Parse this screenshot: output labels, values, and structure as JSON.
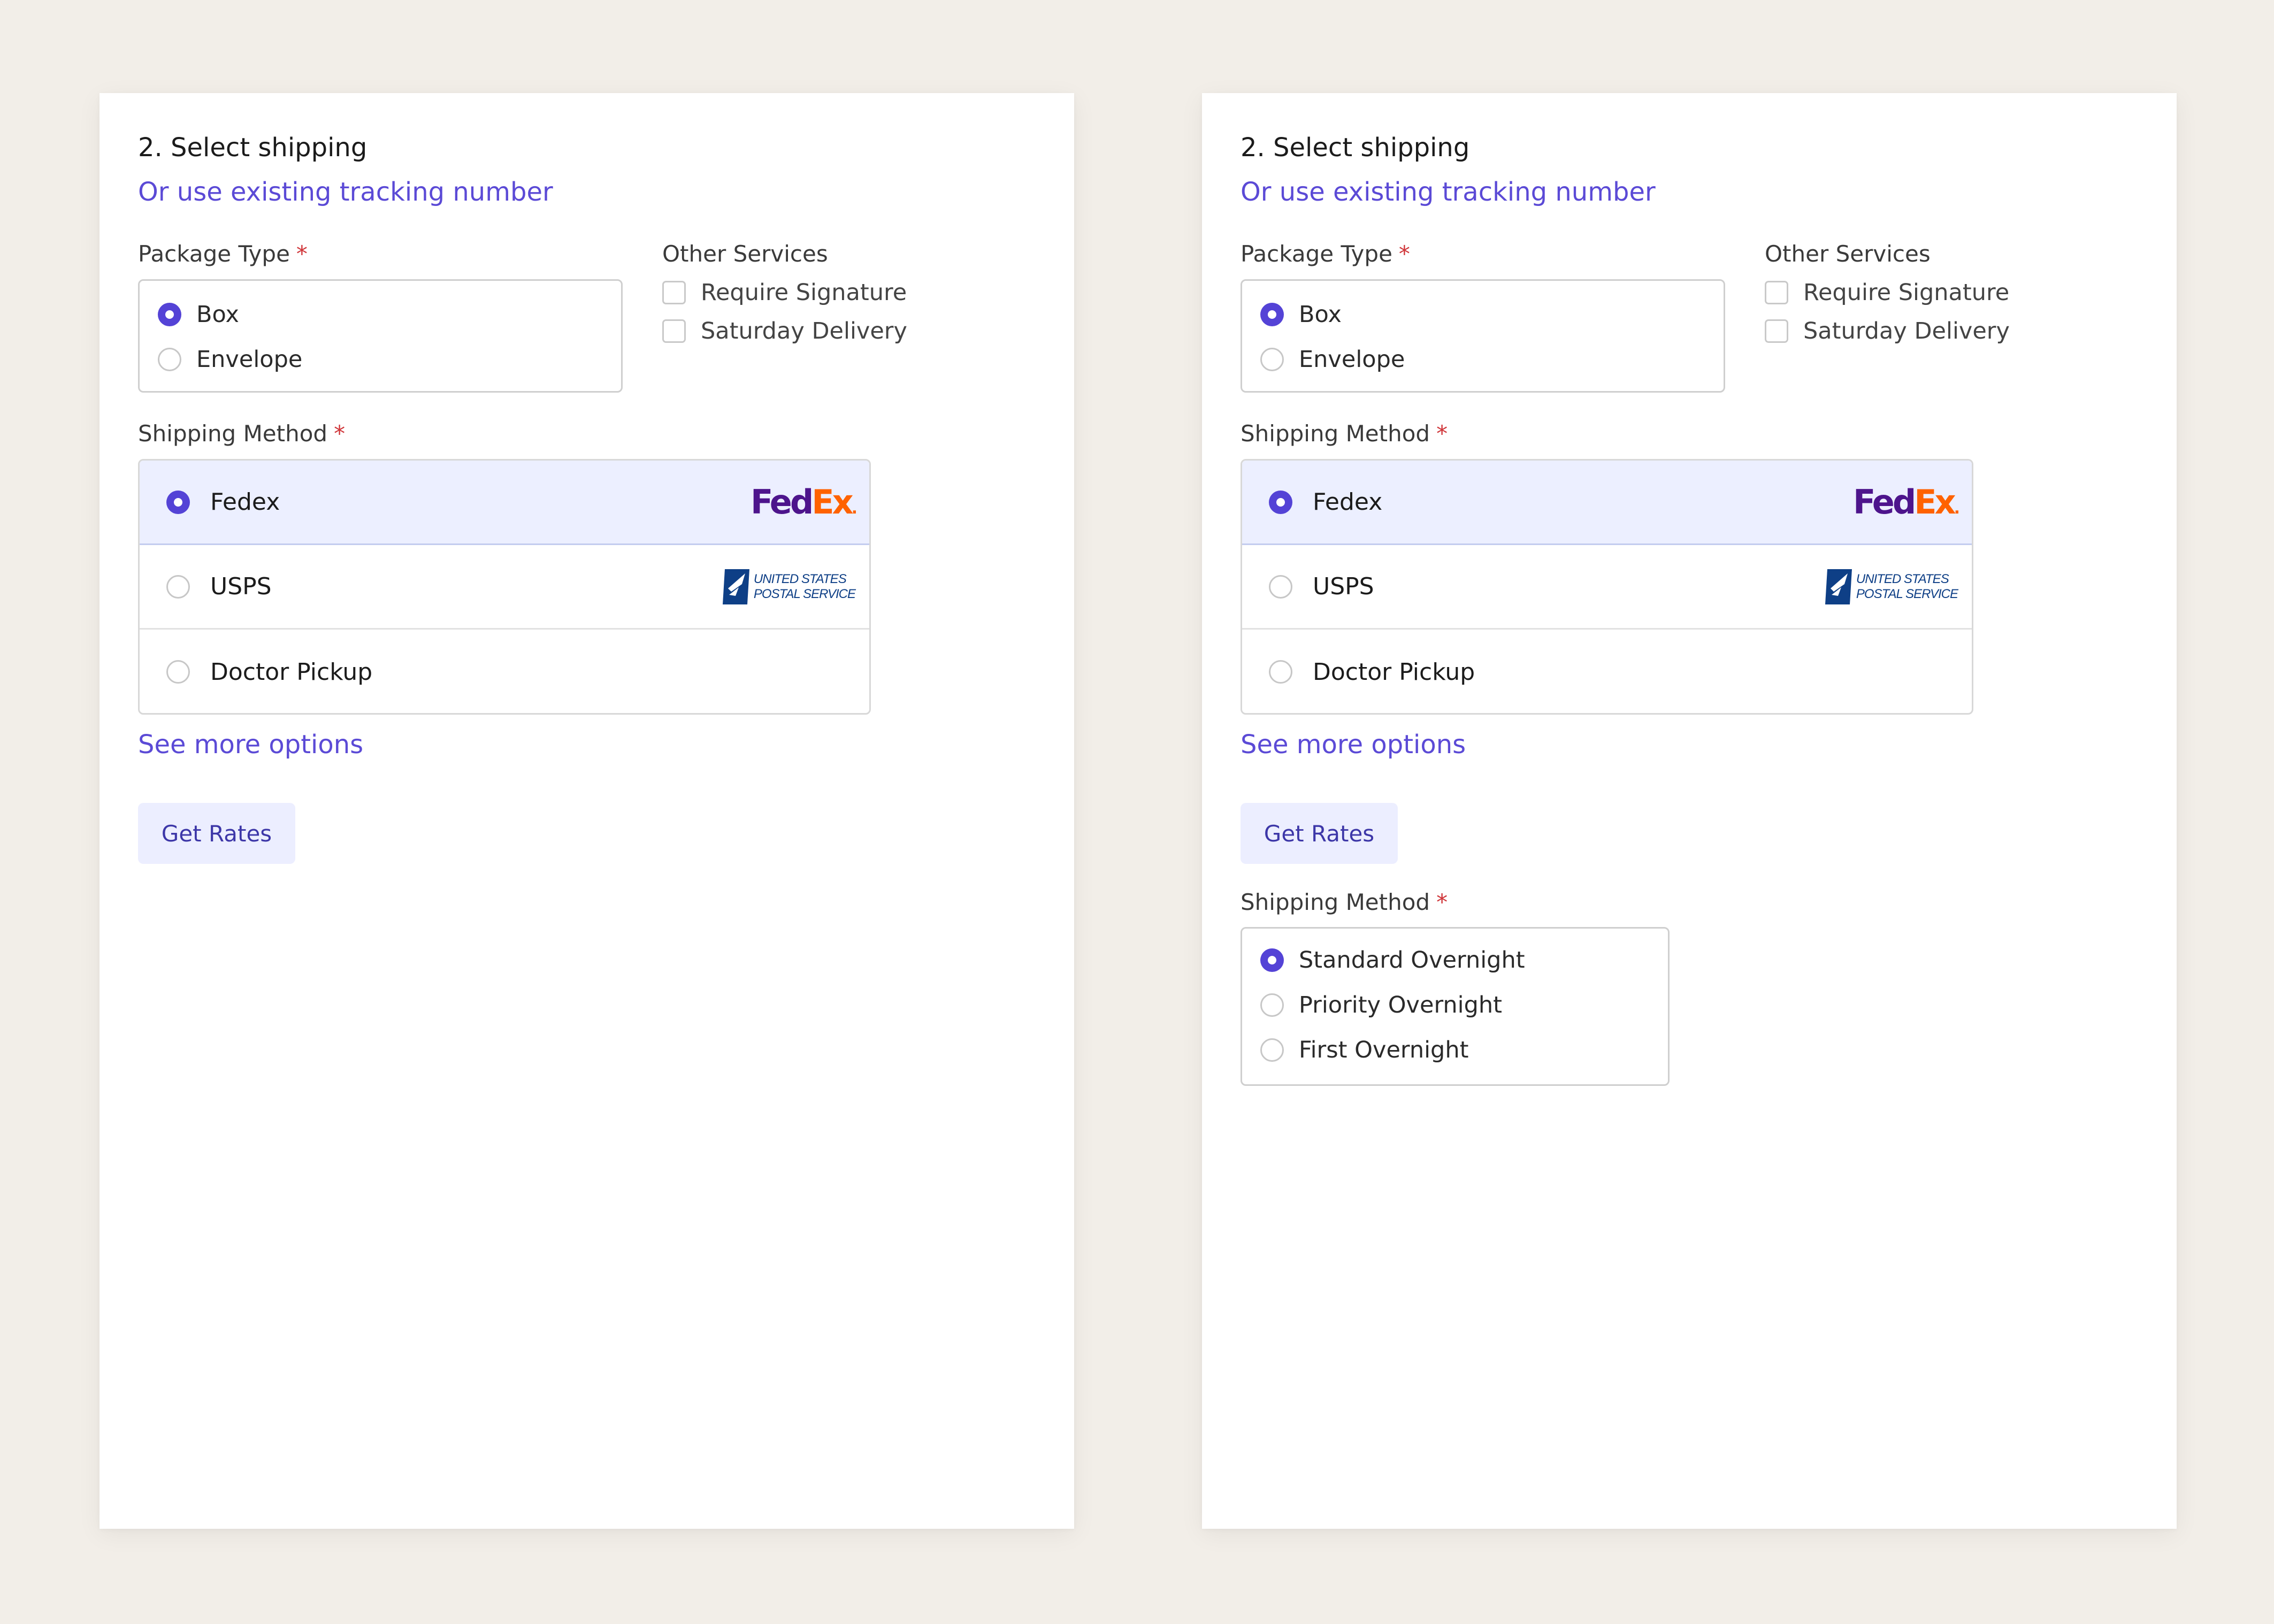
{
  "panels": [
    {
      "section_title": "2. Select shipping",
      "tracking_link": "Or use existing tracking number",
      "package_type": {
        "label": "Package Type",
        "required_mark": "*",
        "options": [
          {
            "label": "Box",
            "selected": true
          },
          {
            "label": "Envelope",
            "selected": false
          }
        ]
      },
      "other_services": {
        "label": "Other Services",
        "options": [
          {
            "label": "Require Signature",
            "checked": false
          },
          {
            "label": "Saturday Delivery",
            "checked": false
          }
        ]
      },
      "shipping_method": {
        "label": "Shipping Method",
        "required_mark": "*",
        "options": [
          {
            "label": "Fedex",
            "selected": true,
            "logo": "fedex-logo"
          },
          {
            "label": "USPS",
            "selected": false,
            "logo": "usps-logo"
          },
          {
            "label": "Doctor Pickup",
            "selected": false
          }
        ]
      },
      "see_more_link": "See more options",
      "get_rates_button": "Get Rates"
    },
    {
      "section_title": "2. Select shipping",
      "tracking_link": "Or use existing tracking number",
      "package_type": {
        "label": "Package Type",
        "required_mark": "*",
        "options": [
          {
            "label": "Box",
            "selected": true
          },
          {
            "label": "Envelope",
            "selected": false
          }
        ]
      },
      "other_services": {
        "label": "Other Services",
        "options": [
          {
            "label": "Require Signature",
            "checked": false
          },
          {
            "label": "Saturday Delivery",
            "checked": false
          }
        ]
      },
      "shipping_method": {
        "label": "Shipping Method",
        "required_mark": "*",
        "options": [
          {
            "label": "Fedex",
            "selected": true,
            "logo": "fedex-logo"
          },
          {
            "label": "USPS",
            "selected": false,
            "logo": "usps-logo"
          },
          {
            "label": "Doctor Pickup",
            "selected": false
          }
        ]
      },
      "see_more_link": "See more options",
      "get_rates_button": "Get Rates",
      "service_level": {
        "label": "Shipping Method",
        "required_mark": "*",
        "options": [
          {
            "label": "Standard Overnight",
            "selected": true
          },
          {
            "label": "Priority Overnight",
            "selected": false
          },
          {
            "label": "First Overnight",
            "selected": false
          }
        ]
      }
    }
  ],
  "logos": {
    "fedex": {
      "fed": "Fed",
      "ex": "Ex",
      "dot": "."
    },
    "usps": {
      "line1": "UNITED STATES",
      "line2": "POSTAL SERVICE"
    }
  },
  "colors": {
    "accent": "#5443d6",
    "link": "#5b4ad6",
    "required": "#d0363a",
    "selected_row_bg": "#ecefff",
    "button_bg": "#eceeff",
    "background": "#f2eee8",
    "fedex_purple": "#4d148c",
    "fedex_orange": "#ff6200",
    "usps_blue": "#0e3f86"
  }
}
